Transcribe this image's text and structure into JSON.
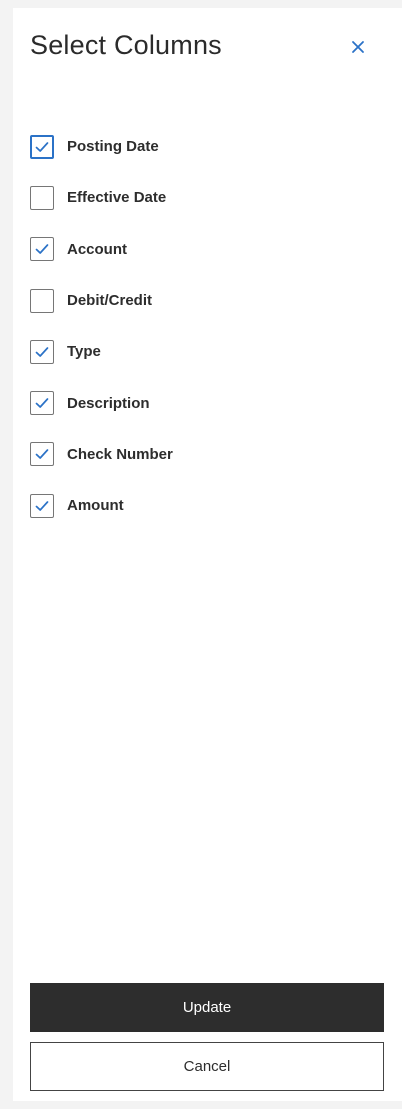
{
  "dialog": {
    "title": "Select Columns",
    "close_icon": "close-icon"
  },
  "columns": [
    {
      "label": "Posting Date",
      "checked": true,
      "focused": true
    },
    {
      "label": "Effective Date",
      "checked": false,
      "focused": false
    },
    {
      "label": "Account",
      "checked": true,
      "focused": false
    },
    {
      "label": "Debit/Credit",
      "checked": false,
      "focused": false
    },
    {
      "label": "Type",
      "checked": true,
      "focused": false
    },
    {
      "label": "Description",
      "checked": true,
      "focused": false
    },
    {
      "label": "Check Number",
      "checked": true,
      "focused": false
    },
    {
      "label": "Amount",
      "checked": true,
      "focused": false
    }
  ],
  "actions": {
    "update_label": "Update",
    "cancel_label": "Cancel"
  },
  "colors": {
    "accent": "#2b72c7",
    "primary_button": "#2d2d2d"
  }
}
